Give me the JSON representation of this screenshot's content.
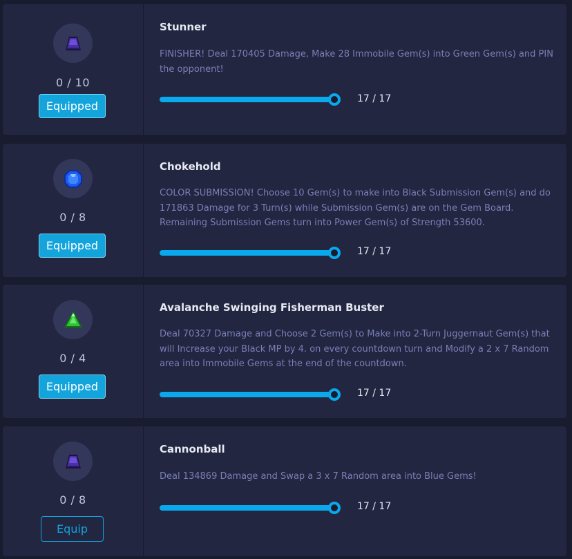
{
  "skills": [
    {
      "name": "Stunner",
      "description": "FINISHER! Deal 170405 Damage, Make 28 Immobile Gem(s) into Green Gem(s) and PIN the opponent!",
      "count": "0 / 10",
      "button_label": "Equipped",
      "equipped": true,
      "level": "17 / 17",
      "level_fraction": 1.0,
      "gem": "purple-gem-icon",
      "gem_color": "#4a2fa8"
    },
    {
      "name": "Chokehold",
      "description": "COLOR SUBMISSION! Choose 10 Gem(s) to make into Black Submission Gem(s) and do 171863 Damage for 3 Turn(s) while Submission Gem(s) are on the Gem Board. Remaining Submission Gems turn into Power Gem(s) of Strength 53600.",
      "count": "0 / 8",
      "button_label": "Equipped",
      "equipped": true,
      "level": "17 / 17",
      "level_fraction": 1.0,
      "gem": "blue-gem-icon",
      "gem_color": "#1d5cf0"
    },
    {
      "name": "Avalanche Swinging Fisherman Buster",
      "description": "Deal 70327 Damage and Choose 2 Gem(s) to Make into 2-Turn Juggernaut Gem(s) that will Increase your Black MP by 4. on every countdown turn and Modify a 2 x 7 Random area into Immobile Gems at the end of the countdown.",
      "count": "0 / 4",
      "button_label": "Equipped",
      "equipped": true,
      "level": "17 / 17",
      "level_fraction": 1.0,
      "gem": "green-gem-icon",
      "gem_color": "#2ec234"
    },
    {
      "name": "Cannonball",
      "description": "Deal 134869 Damage and Swap a 3 x 7 Random area into Blue Gems!",
      "count": "0 / 8",
      "button_label": "Equip",
      "equipped": false,
      "level": "17 / 17",
      "level_fraction": 1.0,
      "gem": "purple-gem-icon",
      "gem_color": "#4a2fa8"
    }
  ]
}
